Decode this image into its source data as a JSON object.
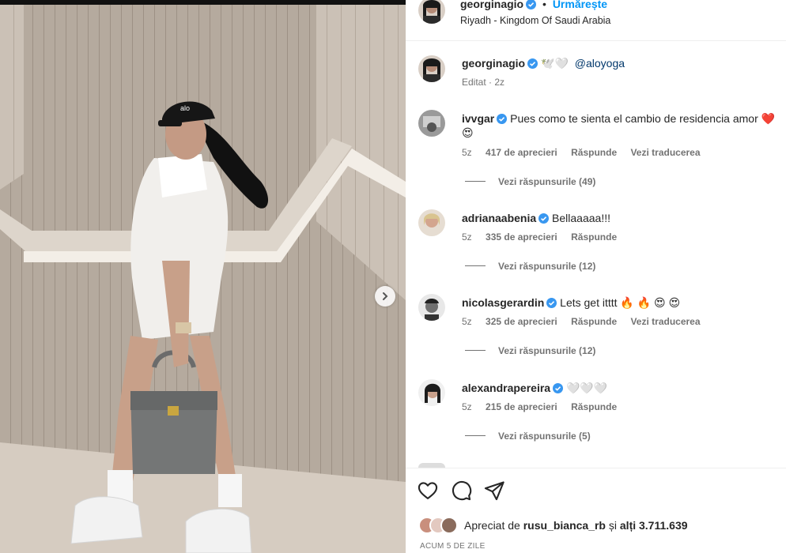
{
  "header": {
    "username": "georginagio",
    "separator": "•",
    "follow_label": "Urmărește",
    "location": "Riyadh - Kingdom Of Saudi Arabia"
  },
  "caption": {
    "username": "georginagio",
    "emoji": "🕊️🤍",
    "mention": "@aloyoga",
    "edited": "Editat · 2z"
  },
  "comments": [
    {
      "username": "ivvgar",
      "text": "Pues como te sienta el cambio de residencia amor ❤️",
      "text2": "😍",
      "time": "5z",
      "likes": "417 de aprecieri",
      "reply": "Răspunde",
      "translate": "Vezi traducerea",
      "replies": "Vezi răspunsurile (49)"
    },
    {
      "username": "adrianaabenia",
      "text": "Bellaaaaa!!!",
      "time": "5z",
      "likes": "335 de aprecieri",
      "reply": "Răspunde",
      "replies": "Vezi răspunsurile (12)"
    },
    {
      "username": "nicolasgerardin",
      "text": "Lets get itttt 🔥 🔥 😍 😍",
      "time": "5z",
      "likes": "325 de aprecieri",
      "reply": "Răspunde",
      "translate": "Vezi traducerea",
      "replies": "Vezi răspunsurile (12)"
    },
    {
      "username": "alexandrapereira",
      "text": "🤍🤍🤍",
      "time": "5z",
      "likes": "215 de aprecieri",
      "reply": "Răspunde",
      "replies": "Vezi răspunsurile (5)"
    }
  ],
  "likes": {
    "prefix": "Apreciat de",
    "user": "rusu_bianca_rb",
    "and": "și",
    "others": "alți 3.711.639"
  },
  "time_ago": "ACUM 5 DE ZILE",
  "colors": {
    "accent": "#0095f6",
    "verified": "#3897f0",
    "muted": "#737373"
  }
}
